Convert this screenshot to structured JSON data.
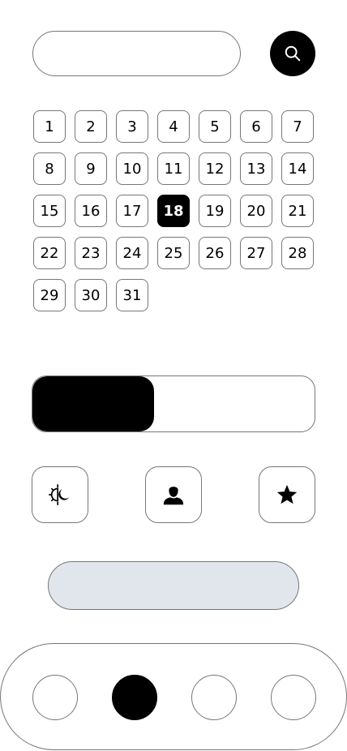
{
  "search": {
    "placeholder": "",
    "value": "",
    "icon": "search-icon"
  },
  "calendar": {
    "days": [
      "1",
      "2",
      "3",
      "4",
      "5",
      "6",
      "7",
      "8",
      "9",
      "10",
      "11",
      "12",
      "13",
      "14",
      "15",
      "16",
      "17",
      "18",
      "19",
      "20",
      "21",
      "22",
      "23",
      "24",
      "25",
      "26",
      "27",
      "28",
      "29",
      "30",
      "31"
    ],
    "selected": "18"
  },
  "progress": {
    "fraction": 0.43
  },
  "actions": [
    {
      "icon": "sun-moon-icon"
    },
    {
      "icon": "user-icon"
    },
    {
      "icon": "star-icon"
    }
  ],
  "pill_button": {
    "label": ""
  },
  "bottom_nav": {
    "count": 4,
    "active_index": 1
  },
  "colors": {
    "accent": "#000000",
    "pill_fill": "#e1e6ec",
    "border": "#777777",
    "background": "#ffffff"
  }
}
